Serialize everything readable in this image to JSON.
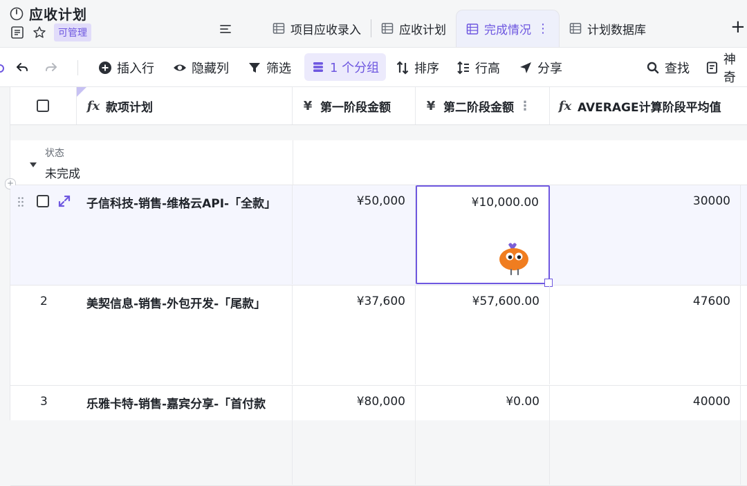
{
  "header": {
    "title": "应收计划",
    "permission_badge": "可管理",
    "tabs": [
      {
        "label": "项目应收录入",
        "active": false
      },
      {
        "label": "应收计划",
        "active": false
      },
      {
        "label": "完成情况",
        "active": true
      },
      {
        "label": "计划数据库",
        "active": false
      }
    ],
    "add_tab": "+"
  },
  "toolbar": {
    "insert_row": "插入行",
    "hide_columns": "隐藏列",
    "filter": "筛选",
    "group": "1 个分组",
    "sort": "排序",
    "row_height": "行高",
    "share": "分享",
    "find": "查找",
    "more": "神奇"
  },
  "columns": [
    {
      "label": "款项计划",
      "icon": "formula-icon"
    },
    {
      "label": "第一阶段金额",
      "icon": "currency-icon"
    },
    {
      "label": "第二阶段金额",
      "icon": "currency-icon"
    },
    {
      "label": "AVERAGE计算阶段平均值",
      "icon": "formula-icon"
    }
  ],
  "group": {
    "field": "状态",
    "value": "未完成"
  },
  "rows": [
    {
      "num": "",
      "name": "子信科技-销售-维格云API-「全款」",
      "stage1": "¥50,000",
      "stage2": "¥10,000.00",
      "average": "30000"
    },
    {
      "num": "2",
      "name": "美契信息-销售-外包开发-「尾款」",
      "stage1": "¥37,600",
      "stage2": "¥57,600.00",
      "average": "47600"
    },
    {
      "num": "3",
      "name": "乐雅卡特-销售-嘉宾分享-「首付款",
      "stage1": "¥80,000",
      "stage2": "¥0.00",
      "average": "40000"
    }
  ],
  "colors": {
    "accent": "#6e57e0",
    "mascot": "#f07d20"
  }
}
